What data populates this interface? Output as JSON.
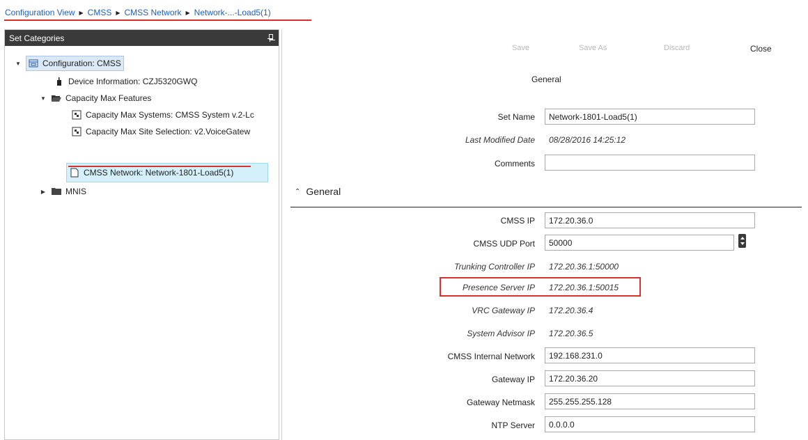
{
  "breadcrumb": {
    "items": [
      "Configuration View",
      "CMSS",
      "CMSS Network",
      "Network-...-Load5(1)"
    ]
  },
  "left_panel": {
    "title": "Set Categories",
    "tree": {
      "root": "Configuration: CMSS",
      "device_info": "Device Information: CZJ5320GWQ",
      "capacity_max": "Capacity Max Features",
      "cm_systems": "Capacity Max Systems: CMSS System v.2-Lc",
      "cm_site": "Capacity Max Site Selection: v2.VoiceGatew",
      "cmss_network": "CMSS Network: Network-1801-Load5(1)",
      "mnis": "MNIS"
    }
  },
  "toolbar": {
    "save": "Save",
    "save_as": "Save As",
    "discard": "Discard",
    "close": "Close"
  },
  "general_caption": "General",
  "form": {
    "set_name_label": "Set Name",
    "set_name_value": "Network-1801-Load5(1)",
    "last_modified_label": "Last Modified Date",
    "last_modified_value": "08/28/2016 14:25:12",
    "comments_label": "Comments",
    "comments_value": ""
  },
  "general_section": {
    "title": "General",
    "cmss_ip_label": "CMSS IP",
    "cmss_ip_value": "172.20.36.0",
    "cmss_udp_label": "CMSS UDP Port",
    "cmss_udp_value": "50000",
    "trunking_label": "Trunking Controller IP",
    "trunking_value": "172.20.36.1:50000",
    "presence_label": "Presence Server IP",
    "presence_value": "172.20.36.1:50015",
    "vrc_label": "VRC Gateway IP",
    "vrc_value": "172.20.36.4",
    "advisor_label": "System Advisor IP",
    "advisor_value": "172.20.36.5",
    "internal_label": "CMSS Internal Network",
    "internal_value": "192.168.231.0",
    "gateway_ip_label": "Gateway IP",
    "gateway_ip_value": "172.20.36.20",
    "netmask_label": "Gateway Netmask",
    "netmask_value": "255.255.255.128",
    "ntp_label": "NTP Server",
    "ntp_value": "0.0.0.0"
  },
  "colors": {
    "link": "#1f5fb4",
    "annotation_red": "#d9302b",
    "header_dark": "#3a3a3a",
    "selection": "#d3f0fb"
  },
  "icons": [
    "chevron-right-icon",
    "pin-icon",
    "config-icon",
    "device-icon",
    "folder-open-icon",
    "folder-icon",
    "set-icon",
    "document-icon",
    "spin-up-icon",
    "spin-down-icon",
    "chevron-up-icon"
  ]
}
